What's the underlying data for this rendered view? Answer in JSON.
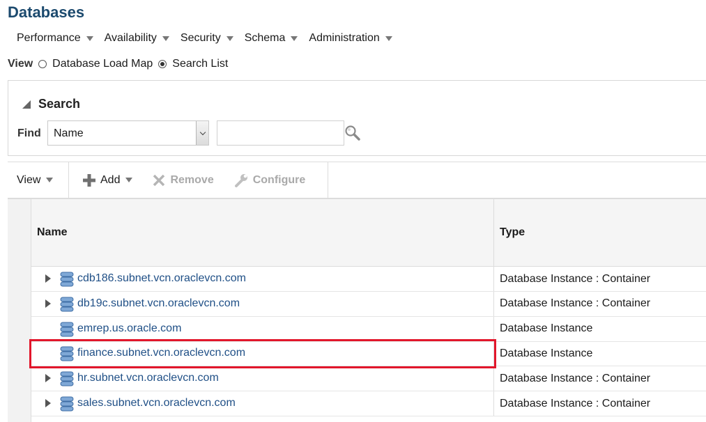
{
  "page": {
    "title": "Databases"
  },
  "menu": [
    {
      "label": "Performance"
    },
    {
      "label": "Availability"
    },
    {
      "label": "Security"
    },
    {
      "label": "Schema"
    },
    {
      "label": "Administration"
    }
  ],
  "view_mode": {
    "label": "View",
    "options": [
      {
        "label": "Database Load Map",
        "checked": false
      },
      {
        "label": "Search List",
        "checked": true
      }
    ]
  },
  "search": {
    "title": "Search",
    "find_label": "Find",
    "field_selected": "Name",
    "query_value": ""
  },
  "toolbar": {
    "view_label": "View",
    "add_label": "Add",
    "remove_label": "Remove",
    "configure_label": "Configure"
  },
  "table": {
    "columns": {
      "name": "Name",
      "type": "Type"
    },
    "rows": [
      {
        "name": "cdb186.subnet.vcn.oraclevcn.com",
        "type": "Database Instance : Container",
        "expandable": true
      },
      {
        "name": "db19c.subnet.vcn.oraclevcn.com",
        "type": "Database Instance : Container",
        "expandable": true
      },
      {
        "name": "emrep.us.oracle.com",
        "type": "Database Instance",
        "expandable": false
      },
      {
        "name": "finance.subnet.vcn.oraclevcn.com",
        "type": "Database Instance",
        "expandable": false,
        "highlighted": true
      },
      {
        "name": "hr.subnet.vcn.oraclevcn.com",
        "type": "Database Instance : Container",
        "expandable": true
      },
      {
        "name": "sales.subnet.vcn.oraclevcn.com",
        "type": "Database Instance : Container",
        "expandable": true
      }
    ]
  },
  "colors": {
    "title": "#1c4a6e",
    "link": "#1f4f86",
    "highlight": "#e2162b",
    "disabled": "#a9a9a9"
  }
}
